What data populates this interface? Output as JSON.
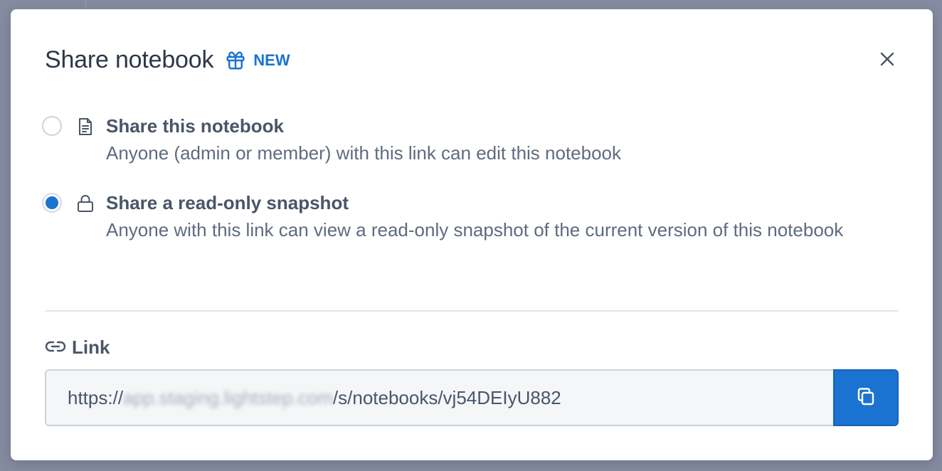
{
  "modal": {
    "title": "Share notebook",
    "badge": "NEW",
    "close_icon": "close-icon"
  },
  "options": [
    {
      "title": "Share this notebook",
      "description": "Anyone (admin or member) with this link can edit this notebook",
      "icon": "document-icon",
      "selected": false
    },
    {
      "title": "Share a read-only snapshot",
      "description": "Anyone with this link can view a read-only snapshot of the current version of this notebook",
      "icon": "lock-icon",
      "selected": true
    }
  ],
  "link": {
    "label": "Link",
    "prefix": "https://",
    "host_blurred": "app.staging.lightstep.com",
    "path": "/s/notebooks/vj54DEIyU882",
    "copy_icon": "copy-icon"
  },
  "colors": {
    "accent": "#1a73d1",
    "overlay": "#858ca1"
  }
}
